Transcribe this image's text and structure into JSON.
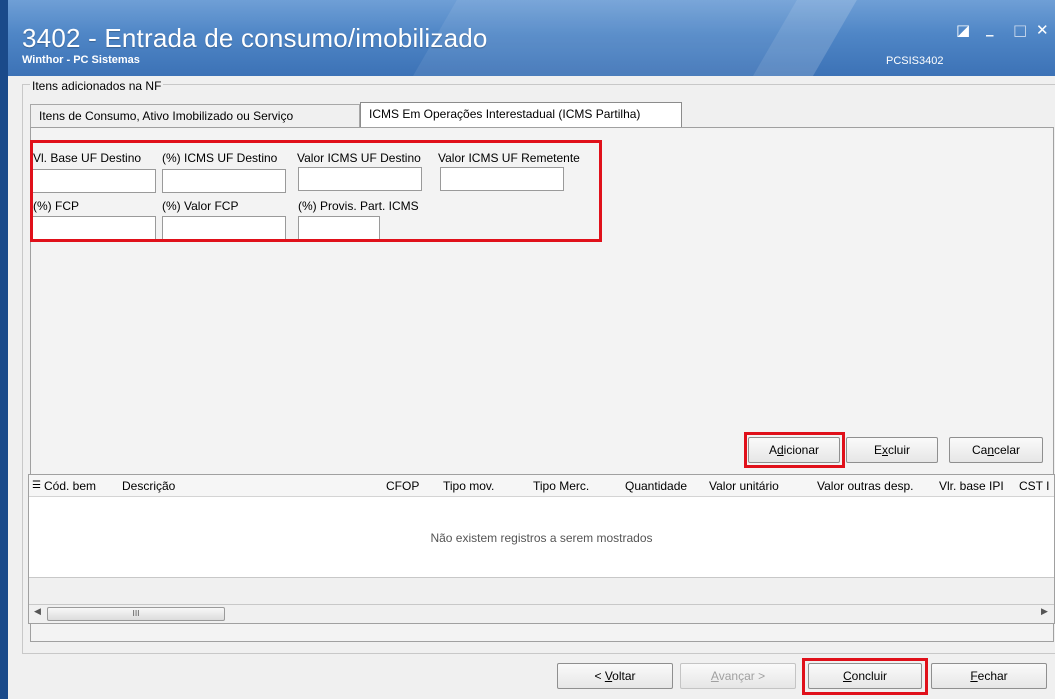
{
  "window": {
    "title": "3402 - Entrada de consumo/imobilizado",
    "subtitle": "Winthor - PC Sistemas",
    "code": "PCSIS3402",
    "controls": {
      "restore": "◪",
      "minimize": "_",
      "maximize": "□",
      "close": "✕"
    }
  },
  "group": {
    "label": "Itens adicionados na NF"
  },
  "tabs": [
    {
      "label": "Itens de Consumo,  Ativo Imobilizado ou Serviço"
    },
    {
      "label": "ICMS Em Operações Interestadual (ICMS Partilha)"
    }
  ],
  "fields": {
    "vl_base_uf_destino": {
      "label": "Vl. Base UF Destino",
      "value": ""
    },
    "icms_uf_destino": {
      "label": "(%) ICMS UF Destino",
      "value": ""
    },
    "valor_icms_uf_destino": {
      "label": "Valor ICMS UF Destino",
      "value": ""
    },
    "valor_icms_uf_remetente": {
      "label": "Valor ICMS UF Remetente",
      "value": ""
    },
    "fcp": {
      "label": "(%) FCP",
      "value": ""
    },
    "valor_fcp": {
      "label": "(%) Valor FCP",
      "value": ""
    },
    "provis_part_icms": {
      "label": "(%) Provis. Part. ICMS",
      "value": ""
    }
  },
  "actions": {
    "adicionar": {
      "pre": "A",
      "key": "d",
      "post": "icionar"
    },
    "excluir": {
      "pre": "E",
      "key": "x",
      "post": "cluir"
    },
    "cancelar": {
      "pre": "Ca",
      "key": "n",
      "post": "celar"
    }
  },
  "grid": {
    "columns": [
      "Cód. bem",
      "Descrição",
      "CFOP",
      "Tipo mov.",
      "Tipo Merc.",
      "Quantidade",
      "Valor unitário",
      "Valor outras desp.",
      "Vlr. base IPI",
      "CST I"
    ],
    "empty_message": "Não existem registros a serem mostrados",
    "scroll": {
      "left": "◀",
      "right": "▶",
      "thumb": "III"
    }
  },
  "footer": {
    "voltar": {
      "pre": "< ",
      "key": "V",
      "post": "oltar"
    },
    "avancar": {
      "pre": "",
      "key": "A",
      "post": "vançar >"
    },
    "concluir": {
      "pre": "",
      "key": "C",
      "post": "oncluir"
    },
    "fechar": {
      "pre": "",
      "key": "F",
      "post": "echar"
    }
  },
  "colors": {
    "highlight": "#e0101a",
    "titlebar": "#4f86c6"
  }
}
